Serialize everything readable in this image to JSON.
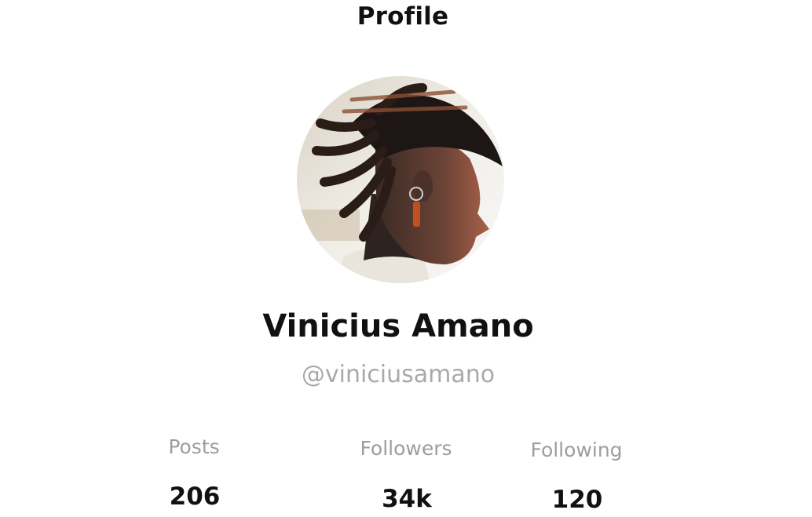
{
  "header": {
    "title": "Profile"
  },
  "profile": {
    "name": "Vinicius Amano",
    "handle": "@viniciusamano",
    "avatar_icon": "profile-photo"
  },
  "stats": [
    {
      "label": "Posts",
      "value": "206"
    },
    {
      "label": "Followers",
      "value": "34k"
    },
    {
      "label": "Following",
      "value": "120"
    }
  ],
  "colors": {
    "background": "#ffffff",
    "text_primary": "#111111",
    "text_secondary": "#a9a9a9"
  }
}
